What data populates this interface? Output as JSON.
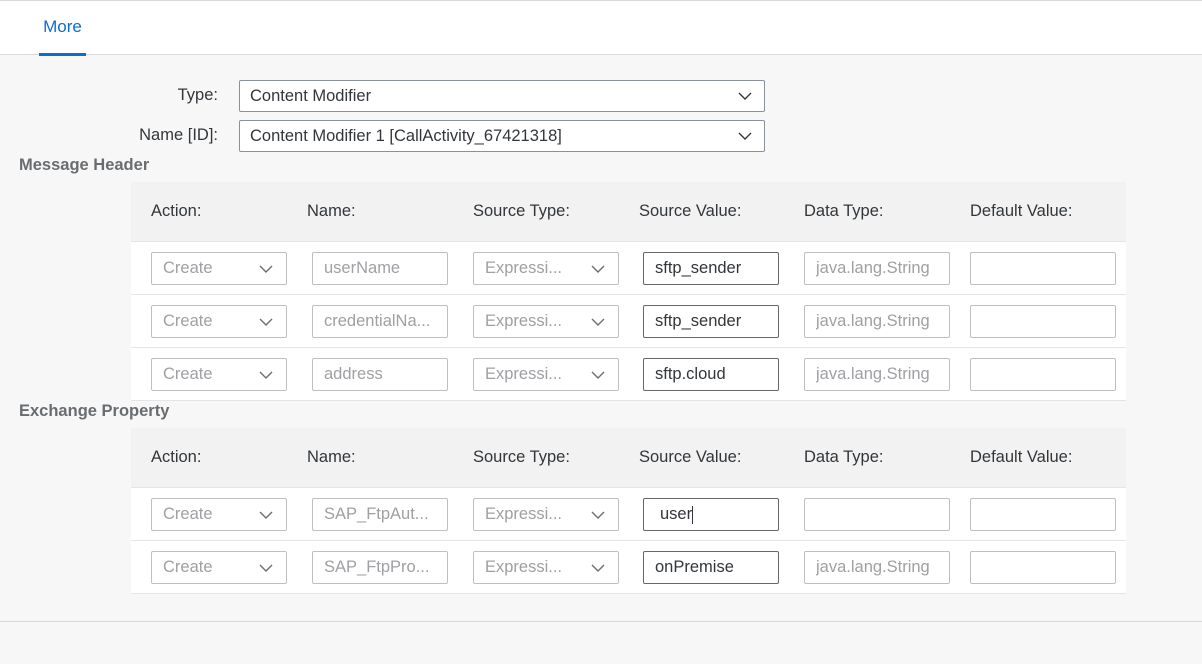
{
  "tabs": {
    "more": "More"
  },
  "form": {
    "type_label": "Type:",
    "type_value": "Content Modifier",
    "name_label": "Name [ID]:",
    "name_value": "Content Modifier 1 [CallActivity_67421318]"
  },
  "message_header": {
    "title": "Message Header",
    "columns": [
      "Action:",
      "Name:",
      "Source Type:",
      "Source Value:",
      "Data Type:",
      "Default Value:"
    ],
    "rows": [
      {
        "action": "Create",
        "name": "userName",
        "source_type": "Expressi...",
        "source_value": "sftp_sender",
        "data_type": "java.lang.String",
        "default_value": ""
      },
      {
        "action": "Create",
        "name": "credentialNa...",
        "source_type": "Expressi...",
        "source_value": "sftp_sender",
        "data_type": "java.lang.String",
        "default_value": ""
      },
      {
        "action": "Create",
        "name": "address",
        "source_type": "Expressi...",
        "source_value": "sftp.cloud",
        "data_type": "java.lang.String",
        "default_value": ""
      }
    ]
  },
  "exchange_property": {
    "title": "Exchange Property",
    "columns": [
      "Action:",
      "Name:",
      "Source Type:",
      "Source Value:",
      "Data Type:",
      "Default Value:"
    ],
    "rows": [
      {
        "action": "Create",
        "name": "SAP_FtpAut...",
        "source_type": "Expressi...",
        "source_value": "user",
        "data_type": "",
        "default_value": ""
      },
      {
        "action": "Create",
        "name": "SAP_FtpPro...",
        "source_type": "Expressi...",
        "source_value": "onPremise",
        "data_type": "java.lang.String",
        "default_value": ""
      }
    ]
  },
  "colors": {
    "accent": "#0a6ed1",
    "background": "#f7f7f7",
    "header": "#f2f2f2"
  }
}
